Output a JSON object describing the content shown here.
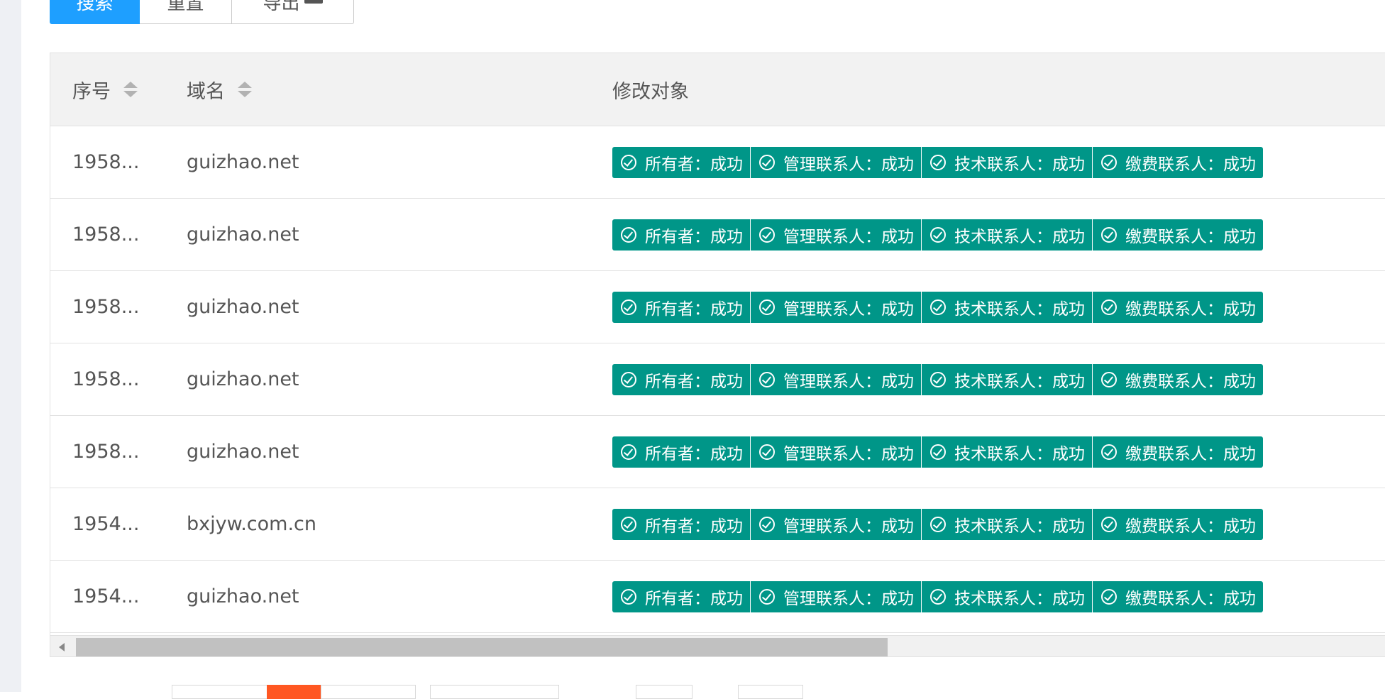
{
  "toolbar": {
    "search_label": "搜索",
    "reset_label": "重置",
    "export_label": "导出"
  },
  "table": {
    "columns": [
      "序号",
      "域名",
      "修改对象"
    ],
    "rows": [
      {
        "id": "1958...",
        "domain": "guizhao.net",
        "tags": [
          "所有者：成功",
          "管理联系人：成功",
          "技术联系人：成功",
          "缴费联系人：成功"
        ]
      },
      {
        "id": "1958...",
        "domain": "guizhao.net",
        "tags": [
          "所有者：成功",
          "管理联系人：成功",
          "技术联系人：成功",
          "缴费联系人：成功"
        ]
      },
      {
        "id": "1958...",
        "domain": "guizhao.net",
        "tags": [
          "所有者：成功",
          "管理联系人：成功",
          "技术联系人：成功",
          "缴费联系人：成功"
        ]
      },
      {
        "id": "1958...",
        "domain": "guizhao.net",
        "tags": [
          "所有者：成功",
          "管理联系人：成功",
          "技术联系人：成功",
          "缴费联系人：成功"
        ]
      },
      {
        "id": "1958...",
        "domain": "guizhao.net",
        "tags": [
          "所有者：成功",
          "管理联系人：成功",
          "技术联系人：成功",
          "缴费联系人：成功"
        ]
      },
      {
        "id": "1954...",
        "domain": "bxjyw.com.cn",
        "tags": [
          "所有者：成功",
          "管理联系人：成功",
          "技术联系人：成功",
          "缴费联系人：成功"
        ]
      },
      {
        "id": "1954...",
        "domain": "guizhao.net",
        "tags": [
          "所有者：成功",
          "管理联系人：成功",
          "技术联系人：成功",
          "缴费联系人：成功"
        ]
      }
    ]
  },
  "colors": {
    "primary": "#1e9fff",
    "success_tag": "#009688",
    "pager_active": "#ff5722",
    "header_bg": "#f2f2f2"
  },
  "icons": {
    "tag_icon": "check-circle-icon",
    "sort_icon": "sort-icon",
    "export_icon": "folder-icon"
  }
}
